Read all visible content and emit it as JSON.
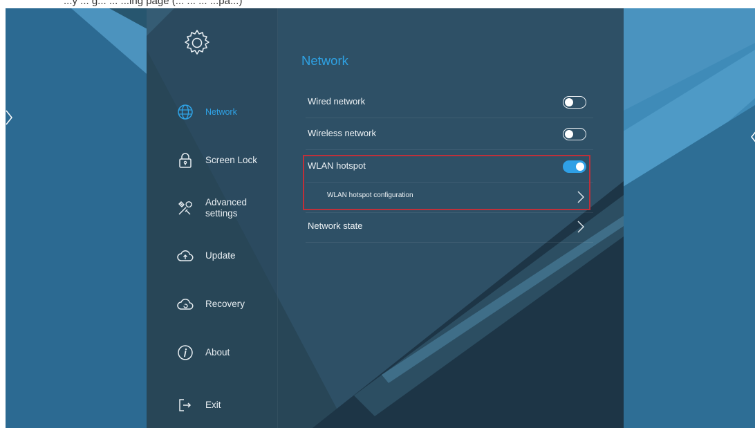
{
  "caption": "...y ... g... ... ...ing page (... ... ... ...pa...)",
  "sidebar": {
    "logo_icon": "gear-icon",
    "items": [
      {
        "label": "Network",
        "icon": "globe-icon",
        "active": true
      },
      {
        "label": "Screen Lock",
        "icon": "lock-icon"
      },
      {
        "label": "Advanced settings",
        "icon": "tools-icon"
      },
      {
        "label": "Update",
        "icon": "cloud-upload-icon"
      },
      {
        "label": "Recovery",
        "icon": "cloud-restore-icon"
      },
      {
        "label": "About",
        "icon": "info-icon"
      },
      {
        "label": "Exit",
        "icon": "exit-icon"
      }
    ]
  },
  "main": {
    "title": "Network",
    "rows": [
      {
        "label": "Wired network",
        "control": "toggle",
        "state": "off"
      },
      {
        "label": "Wireless network",
        "control": "toggle",
        "state": "off"
      },
      {
        "label": "WLAN hotspot",
        "control": "toggle",
        "state": "on"
      },
      {
        "label": "WLAN hotspot configuration",
        "control": "chevron"
      },
      {
        "label": "Network state",
        "control": "chevron"
      }
    ]
  },
  "colors": {
    "accent": "#2ea2e4",
    "highlight_box": "#c0303a",
    "panel": "#2e4e62",
    "background": "#2f6f97"
  }
}
